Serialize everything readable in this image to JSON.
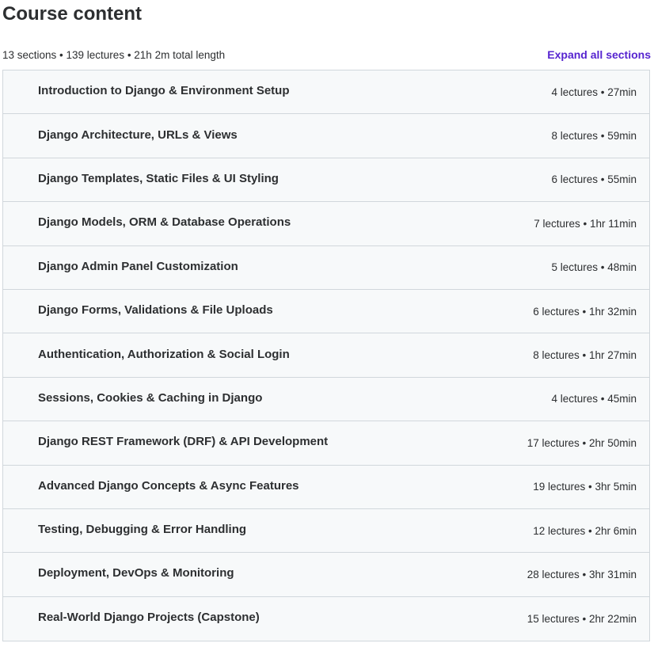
{
  "header": {
    "title": "Course content",
    "summary": "13 sections • 139 lectures • 21h 2m total length",
    "expand_label": "Expand all sections"
  },
  "colors": {
    "accent": "#5624d0",
    "row_background": "#f7f9fa",
    "border": "#d1d7dc",
    "text": "#2d2f31"
  },
  "sections": [
    {
      "title": "Introduction to Django & Environment Setup",
      "meta": "4 lectures • 27min"
    },
    {
      "title": "Django Architecture, URLs & Views",
      "meta": "8 lectures • 59min"
    },
    {
      "title": "Django Templates, Static Files & UI Styling",
      "meta": "6 lectures • 55min"
    },
    {
      "title": "Django Models, ORM & Database Operations",
      "meta": "7 lectures • 1hr 11min"
    },
    {
      "title": "Django Admin Panel Customization",
      "meta": "5 lectures • 48min"
    },
    {
      "title": "Django Forms, Validations & File Uploads",
      "meta": "6 lectures • 1hr 32min"
    },
    {
      "title": "Authentication, Authorization & Social Login",
      "meta": "8 lectures • 1hr 27min"
    },
    {
      "title": "Sessions, Cookies & Caching in Django",
      "meta": "4 lectures • 45min"
    },
    {
      "title": "Django REST Framework (DRF) & API Development",
      "meta": "17 lectures • 2hr 50min"
    },
    {
      "title": "Advanced Django Concepts & Async Features",
      "meta": "19 lectures • 3hr 5min"
    },
    {
      "title": "Testing, Debugging & Error Handling",
      "meta": "12 lectures • 2hr 6min"
    },
    {
      "title": "Deployment, DevOps & Monitoring",
      "meta": "28 lectures • 3hr 31min"
    },
    {
      "title": "Real-World Django Projects (Capstone)",
      "meta": "15 lectures • 2hr 22min"
    }
  ]
}
